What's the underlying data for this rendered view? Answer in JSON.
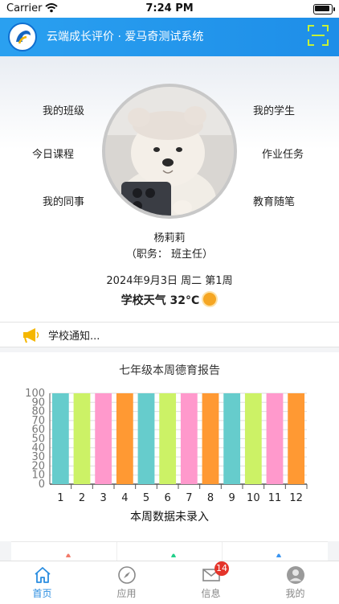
{
  "status_bar": {
    "carrier": "Carrier",
    "time": "7:24 PM"
  },
  "header": {
    "title": "云端成长评价 · 爱马奇测试系统",
    "scan_icon": "scan-icon",
    "accent": "#1e8ee8"
  },
  "menu": {
    "left": [
      "我的班级",
      "今日课程",
      "我的同事"
    ],
    "right": [
      "我的学生",
      "作业任务",
      "教育随笔"
    ]
  },
  "profile": {
    "name": "杨莉莉",
    "role": "（职务： 班主任）"
  },
  "date_line": "2024年9月3日 周二 第1周",
  "weather": {
    "label": "学校天气 32°C",
    "icon": "sun-icon"
  },
  "notice": {
    "text": "学校通知...",
    "icon": "megaphone-icon"
  },
  "report": {
    "title": "七年级本周德育报告",
    "caption": "本周数据未录入"
  },
  "chart_data": {
    "type": "bar",
    "categories": [
      "1",
      "2",
      "3",
      "4",
      "5",
      "6",
      "7",
      "8",
      "9",
      "10",
      "11",
      "12"
    ],
    "values": [
      100,
      100,
      100,
      100,
      100,
      100,
      100,
      100,
      100,
      100,
      100,
      100
    ],
    "colors": [
      "#66cccc",
      "#ccf266",
      "#ff99cc",
      "#ff9933",
      "#66cccc",
      "#ccf266",
      "#ff99cc",
      "#ff9933",
      "#66cccc",
      "#ccf266",
      "#ff99cc",
      "#ff9933"
    ],
    "yticks": [
      0,
      10,
      20,
      30,
      40,
      50,
      60,
      70,
      80,
      90,
      100
    ],
    "ylim": [
      0,
      100
    ],
    "grid": true
  },
  "tabs": [
    {
      "label": "首页",
      "icon": "home-icon",
      "active": true
    },
    {
      "label": "应用",
      "icon": "compass-icon",
      "active": false
    },
    {
      "label": "信息",
      "icon": "mail-icon",
      "active": false,
      "badge": "14"
    },
    {
      "label": "我的",
      "icon": "user-icon",
      "active": false
    }
  ]
}
